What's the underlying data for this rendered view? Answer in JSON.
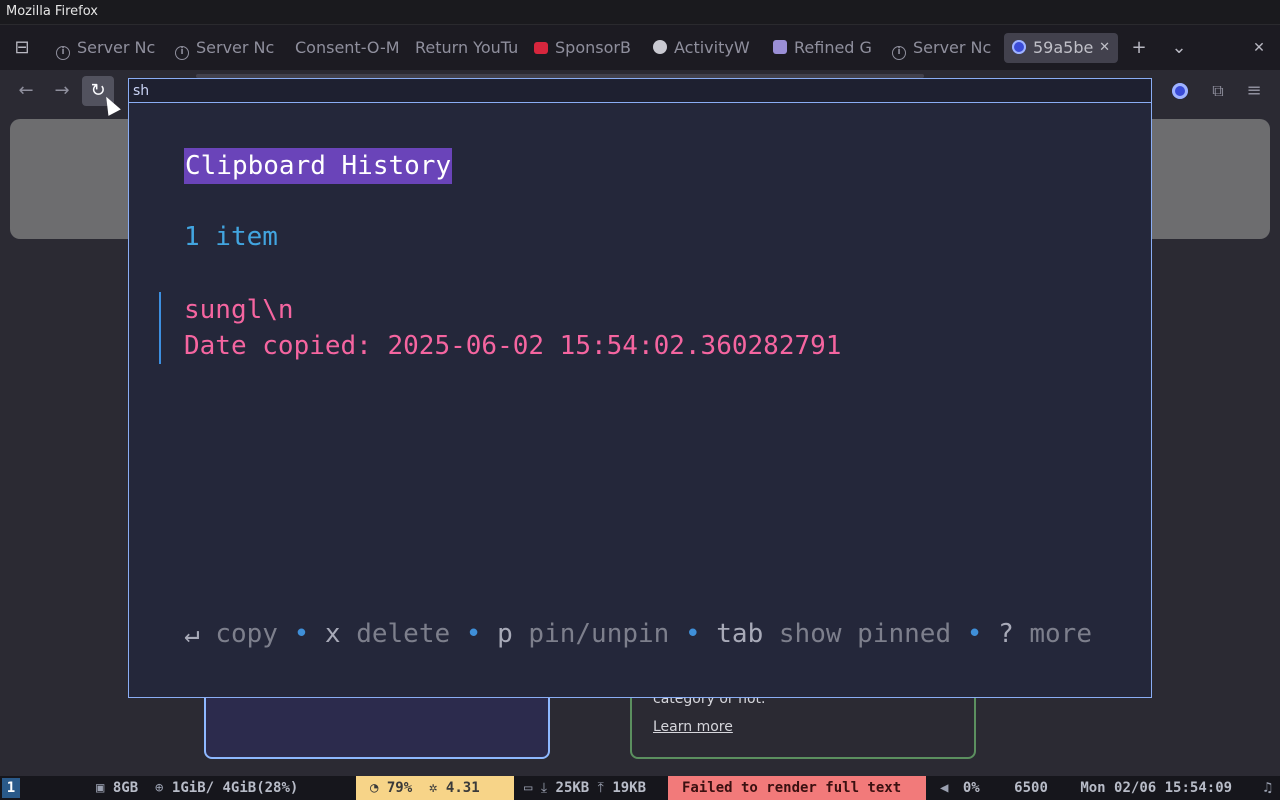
{
  "window": {
    "title": "Mozilla Firefox"
  },
  "tabs": [
    {
      "label": "Server Nc",
      "icon": "info-icon"
    },
    {
      "label": "Server Nc",
      "icon": "info-icon"
    },
    {
      "label": "Consent-O-M",
      "icon": "none"
    },
    {
      "label": "Return YouTu",
      "icon": "none"
    },
    {
      "label": "SponsorB",
      "icon": "youtube-icon"
    },
    {
      "label": "ActivityW",
      "icon": "activitywatch-icon"
    },
    {
      "label": "Refined G",
      "icon": "github-icon"
    },
    {
      "label": "Server Nc",
      "icon": "info-icon"
    },
    {
      "label": "59a5be",
      "icon": "extension-icon",
      "active": true
    }
  ],
  "tab_controls": {
    "close_tab": "✕",
    "new_tab": "+",
    "list_tabs": "⌄",
    "close_window": "✕"
  },
  "navbar": {
    "back": "←",
    "forward": "→",
    "reload": "↻"
  },
  "page": {
    "green_card_text": "category or not.",
    "green_card_link": "Learn more"
  },
  "launcher": {
    "query": "sh",
    "title": "Clipboard History",
    "count": "1 item",
    "items": [
      {
        "line1": "sungl\\n",
        "line2": "Date copied: 2025-06-02 15:54:02.360282791"
      }
    ],
    "help": {
      "copy_key": "↵",
      "copy_label": "copy",
      "delete_key": "x",
      "delete_label": "delete",
      "pin_key": "p",
      "pin_label": "pin/unpin",
      "tab_key": "tab",
      "tab_label": "show pinned",
      "more_key": "?",
      "more_label": "more",
      "separator": "•"
    }
  },
  "statusbar": {
    "workspace": "1",
    "disk": "8GB",
    "memory": "1GiB/ 4GiB(28%)",
    "cpu_percent": "79%",
    "load": "4.31",
    "net_down": "25KB",
    "net_up": "19KB",
    "error": "Failed to render full text",
    "volume": "0%",
    "value": "6500",
    "clock": "Mon 02/06 15:54:09"
  },
  "colors": {
    "popup_bg": "#24273a",
    "popup_border": "#8aadf4",
    "title_highlight": "#6a44b9",
    "count_color": "#42a5e0",
    "item_color": "#f565a0",
    "status_cpu_bg": "#f7d488",
    "status_error_bg": "#f27a7a"
  }
}
